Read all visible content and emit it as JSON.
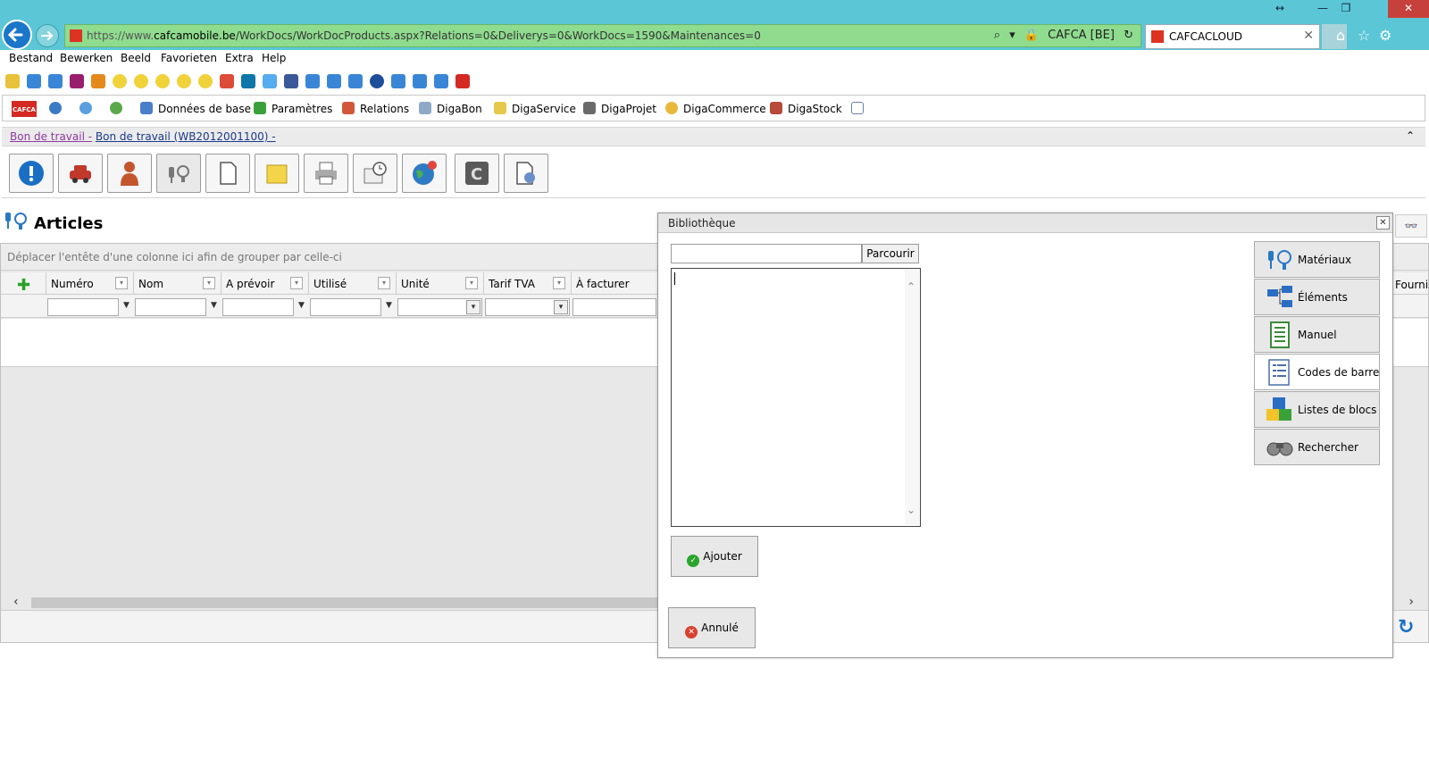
{
  "window": {
    "controls": {
      "resize": "↔",
      "minimize": "—",
      "restore": "❐",
      "close": "✕"
    }
  },
  "browser": {
    "url_protocol": "https://www.",
    "url_domain": "cafcamobile.be",
    "url_path": "/WorkDocs/WorkDocProducts.aspx?Relations=0&Deliverys=0&WorkDocs=1590&Maintenances=0",
    "cert_label": "CAFCA [BE]",
    "tab_title": "CAFCACLOUD",
    "tab_close": "✕",
    "icons": {
      "search": "⌕",
      "lock": "🔒",
      "refresh": "↻",
      "home": "⌂",
      "star": "☆",
      "gear": "⚙"
    }
  },
  "menu": [
    "Bestand",
    "Bewerken",
    "Beeld",
    "Favorieten",
    "Extra",
    "Help"
  ],
  "app_toolbar": {
    "logo": "CAFCA",
    "items": [
      "Données de base",
      "Paramètres",
      "Relations",
      "DigaBon",
      "DigaService",
      "DigaProjet",
      "DigaCommerce",
      "DigaStock"
    ]
  },
  "breadcrumb": {
    "link1": "Bon de travail -",
    "link2": "Bon de travail (WB2012001100) -",
    "collapse": "⌃"
  },
  "page": {
    "title": "Articles",
    "group_hint": "Déplacer l'entête d'une colonne ici afin de grouper par celle-ci",
    "add_row": "✚"
  },
  "grid": {
    "columns": [
      "Numéro",
      "Nom",
      "A prévoir",
      "Utilisé",
      "Unité",
      "Tarif TVA",
      "À facturer"
    ],
    "extra_column": "Fournisseur",
    "scroll_left": "‹",
    "scroll_right": "›"
  },
  "dialog": {
    "title": "Bibliothèque",
    "close": "✕",
    "browse": "Parcourir",
    "add": "Ajouter",
    "cancel": "Annulé",
    "library_buttons": [
      "Matériaux",
      "Éléments",
      "Manuel",
      "Codes de barre",
      "Listes de blocs",
      "Rechercher"
    ],
    "selected": "Codes de barre"
  },
  "colors": {
    "browser_chrome": "#5bc6d6",
    "address_bar": "#8fdc8f",
    "brand_red": "#d42a23",
    "link_blue": "#1b3a8c"
  }
}
